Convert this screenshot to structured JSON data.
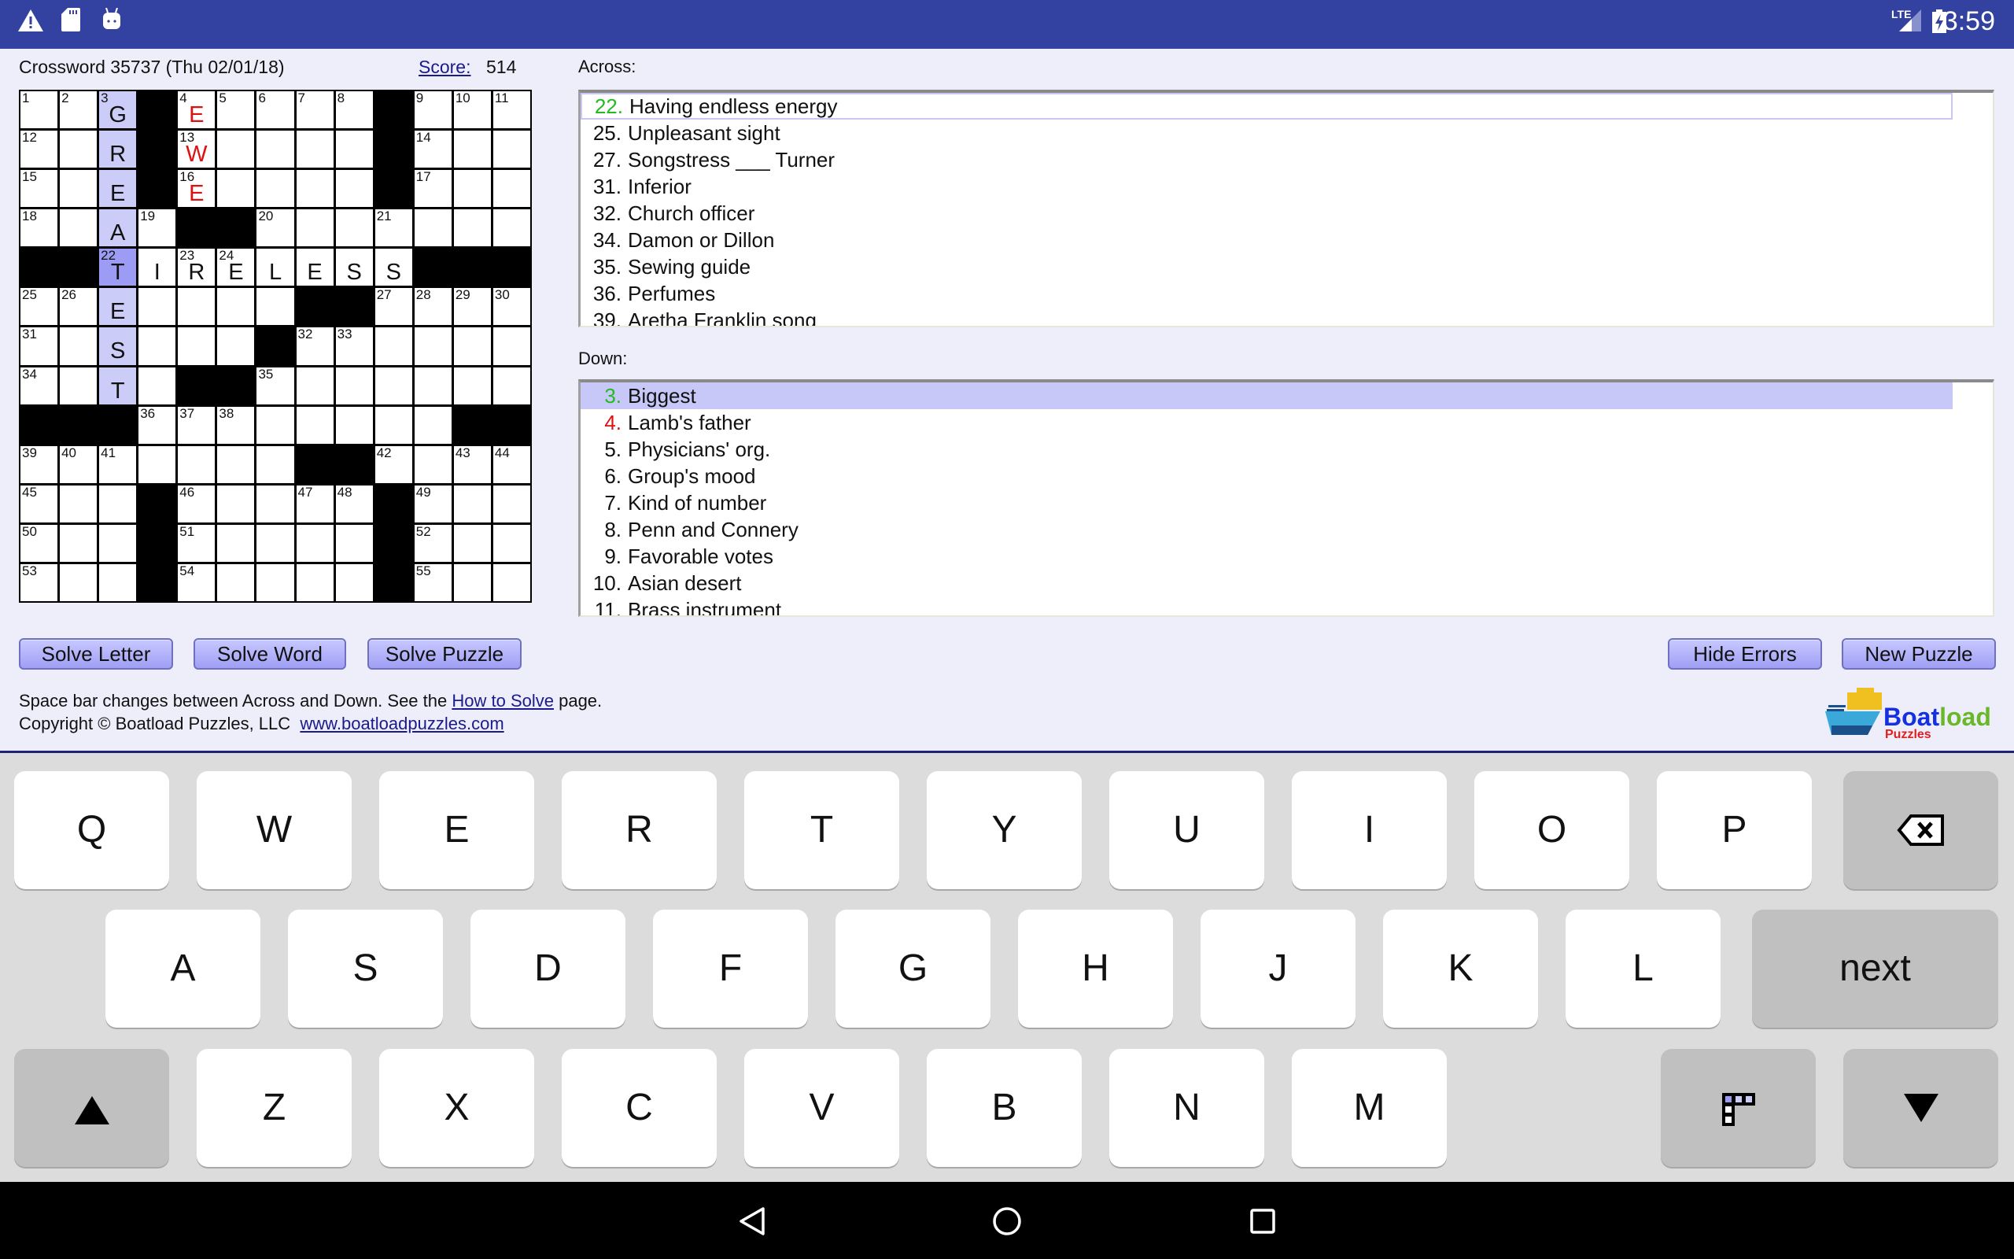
{
  "status_bar": {
    "icons_left": [
      "warning-icon",
      "sd-card-icon",
      "android-icon"
    ],
    "network": "LTE",
    "icons_right": [
      "signal-icon",
      "battery-charging-icon"
    ],
    "time": "3:59",
    "color": "#3341a0"
  },
  "header": {
    "title": "Crossword 35737 (Thu 02/01/18)",
    "score_label": "Score:",
    "score": "514"
  },
  "grid": {
    "blocks": [
      "...#.....#...",
      "...#.....#...",
      "...#.....#...",
      "....##.......",
      "##........###",
      ".......##....",
      "......#......",
      "....##.......",
      "###........##",
      ".......##....",
      "...#.....#...",
      "...#.....#...",
      "...#.....#..."
    ],
    "numbers": [
      [
        "1",
        "2",
        "3",
        "",
        "4",
        "5",
        "6",
        "7",
        "8",
        "",
        "9",
        "10",
        "11"
      ],
      [
        "12",
        "",
        "",
        "",
        "13",
        "",
        "",
        "",
        "",
        "",
        "14",
        "",
        ""
      ],
      [
        "15",
        "",
        "",
        "",
        "16",
        "",
        "",
        "",
        "",
        "",
        "17",
        "",
        ""
      ],
      [
        "18",
        "",
        "",
        "19",
        "",
        "",
        "20",
        "",
        "",
        "21",
        "",
        "",
        ""
      ],
      [
        "",
        "",
        "22",
        "",
        "23",
        "24",
        "",
        "",
        "",
        "",
        "",
        "",
        ""
      ],
      [
        "25",
        "26",
        "",
        "",
        "",
        "",
        "",
        "",
        "",
        "27",
        "28",
        "29",
        "30"
      ],
      [
        "31",
        "",
        "",
        "",
        "",
        "",
        "",
        "32",
        "33",
        "",
        "",
        "",
        ""
      ],
      [
        "34",
        "",
        "",
        "",
        "",
        "",
        "35",
        "",
        "",
        "",
        "",
        "",
        ""
      ],
      [
        "",
        "",
        "",
        "36",
        "37",
        "38",
        "",
        "",
        "",
        "",
        "",
        "",
        ""
      ],
      [
        "39",
        "40",
        "41",
        "",
        "",
        "",
        "",
        "",
        "",
        "42",
        "",
        "43",
        "44"
      ],
      [
        "45",
        "",
        "",
        "",
        "46",
        "",
        "",
        "47",
        "48",
        "",
        "49",
        "",
        ""
      ],
      [
        "50",
        "",
        "",
        "",
        "51",
        "",
        "",
        "",
        "",
        "",
        "52",
        "",
        ""
      ],
      [
        "53",
        "",
        "",
        "",
        "54",
        "",
        "",
        "",
        "",
        "",
        "55",
        "",
        ""
      ]
    ],
    "letters": [
      "  G E        ",
      "  R W        ",
      "  E E        ",
      "  A          ",
      "  TIRELESS   ",
      "  E          ",
      "  S          ",
      "  T          ",
      "             ",
      "             ",
      "             ",
      "             ",
      "             "
    ],
    "error_cells": [
      [
        0,
        4
      ],
      [
        1,
        4
      ],
      [
        2,
        4
      ]
    ],
    "selected_cell": [
      4,
      2
    ],
    "direction": "down",
    "colors": {
      "highlight": "#ccccf8",
      "current": "#9c9cf5",
      "error": "#e01010"
    }
  },
  "across": {
    "label": "Across:",
    "selected": "22",
    "items": [
      {
        "num": "22.",
        "text": "Having endless energy",
        "color": "#22bb22"
      },
      {
        "num": "25.",
        "text": "Unpleasant sight"
      },
      {
        "num": "27.",
        "text": "Songstress ___ Turner"
      },
      {
        "num": "31.",
        "text": "Inferior"
      },
      {
        "num": "32.",
        "text": "Church officer"
      },
      {
        "num": "34.",
        "text": "Damon or Dillon"
      },
      {
        "num": "35.",
        "text": "Sewing guide"
      },
      {
        "num": "36.",
        "text": "Perfumes"
      },
      {
        "num": "39.",
        "text": "Aretha Franklin song"
      }
    ]
  },
  "down": {
    "label": "Down:",
    "selected": "3",
    "items": [
      {
        "num": "3.",
        "text": "Biggest",
        "color": "#22bb22"
      },
      {
        "num": "4.",
        "text": "Lamb's father",
        "color": "#e01010"
      },
      {
        "num": "5.",
        "text": "Physicians' org."
      },
      {
        "num": "6.",
        "text": "Group's mood"
      },
      {
        "num": "7.",
        "text": "Kind of number"
      },
      {
        "num": "8.",
        "text": "Penn and Connery"
      },
      {
        "num": "9.",
        "text": "Favorable votes"
      },
      {
        "num": "10.",
        "text": "Asian desert"
      },
      {
        "num": "11.",
        "text": "Brass instrument"
      }
    ]
  },
  "buttons": {
    "solve_letter": "Solve Letter",
    "solve_word": "Solve Word",
    "solve_puzzle": "Solve Puzzle",
    "hide_errors": "Hide Errors",
    "new_puzzle": "New Puzzle"
  },
  "footer": {
    "line1_pre": "Space bar changes between Across and Down. See the ",
    "how_to_solve": "How to Solve",
    "line1_post": " page.",
    "copyright": "Copyright © Boatload Puzzles, LLC",
    "website": "www.boatloadpuzzles.com",
    "logo_text": "Boatload Puzzles"
  },
  "keyboard": {
    "row1": [
      "Q",
      "W",
      "E",
      "R",
      "T",
      "Y",
      "U",
      "I",
      "O",
      "P"
    ],
    "row2": [
      "A",
      "S",
      "D",
      "F",
      "G",
      "H",
      "J",
      "K",
      "L"
    ],
    "row3": [
      "Z",
      "X",
      "C",
      "V",
      "B",
      "N",
      "M"
    ],
    "next": "next",
    "icons": [
      "backspace-icon",
      "shift-up-icon",
      "grid-toggle-icon",
      "hide-keyboard-icon"
    ]
  },
  "nav_bar": {
    "icons": [
      "back-icon",
      "home-icon",
      "recents-icon"
    ]
  }
}
